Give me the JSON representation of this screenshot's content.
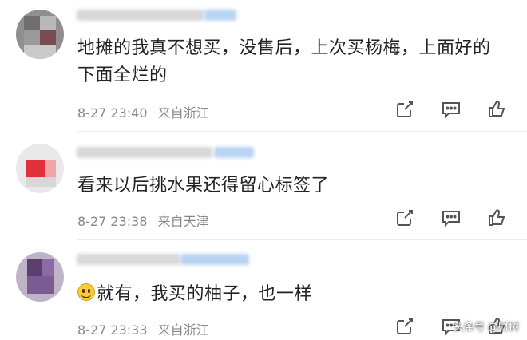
{
  "comments": [
    {
      "text_line1": "地摊的我真不想买，没售后，上次买杨梅，上面好的",
      "text_line2": "下面全烂的",
      "time": "8-27 23:40",
      "location": "来自浙江"
    },
    {
      "text_line1": "看来以后挑水果还得留心标签了",
      "time": "8-27 23:38",
      "location": "来自天津"
    },
    {
      "text_line1": "就有，我买的柚子，也一样",
      "emoji": "smiley-emoji",
      "time": "8-27 23:33",
      "location": "来自浙江"
    }
  ],
  "icons": {
    "share": "share-icon",
    "comment": "comment-icon",
    "like": "like-icon"
  },
  "colors": {
    "text": "#222222",
    "meta": "#888888",
    "icon": "#555555"
  },
  "watermark": "头条号 @财树"
}
